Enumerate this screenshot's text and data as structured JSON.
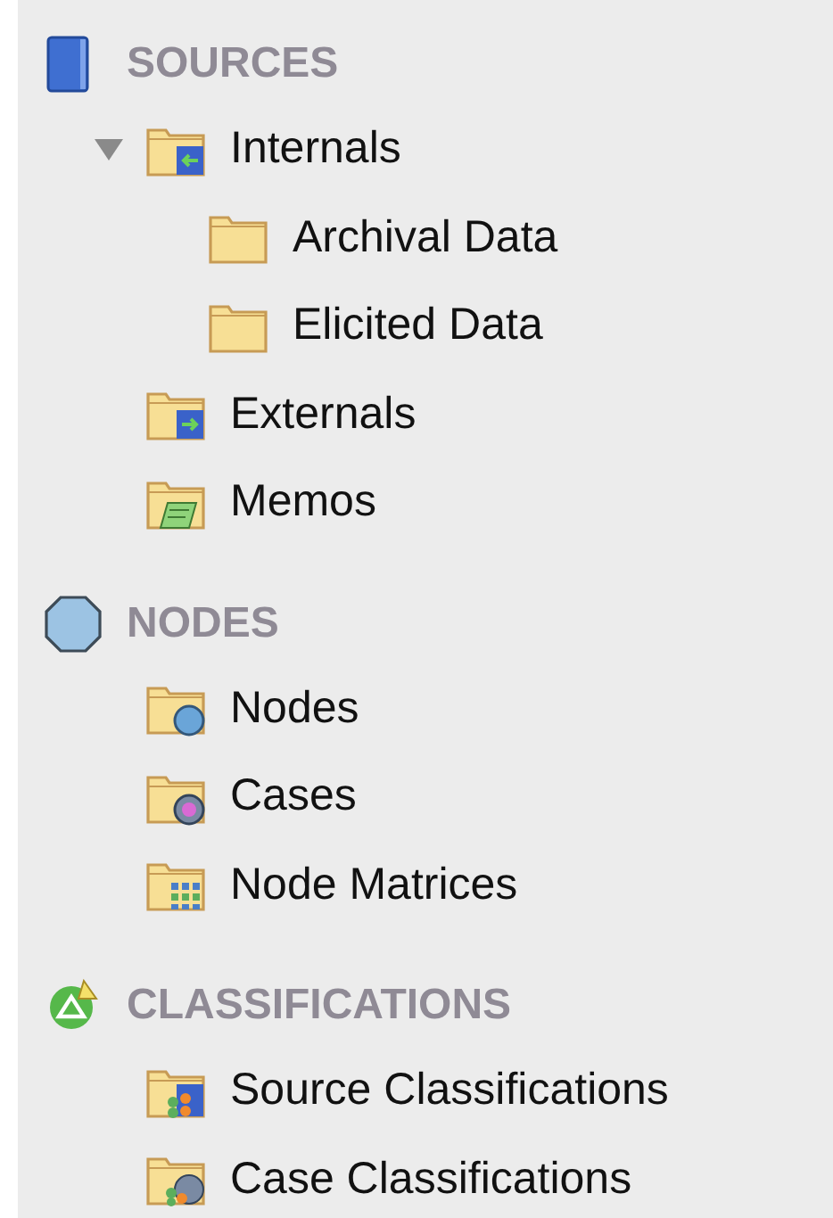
{
  "sections": [
    {
      "title": "SOURCES",
      "kind": "sources",
      "items": [
        {
          "label": "Internals",
          "kind": "internals",
          "expanded": true,
          "children": [
            {
              "label": "Archival Data",
              "kind": "folder"
            },
            {
              "label": "Elicited Data",
              "kind": "folder"
            }
          ]
        },
        {
          "label": "Externals",
          "kind": "externals"
        },
        {
          "label": "Memos",
          "kind": "memos"
        }
      ]
    },
    {
      "title": "NODES",
      "kind": "nodes",
      "items": [
        {
          "label": "Nodes",
          "kind": "nodes"
        },
        {
          "label": "Cases",
          "kind": "cases"
        },
        {
          "label": "Node Matrices",
          "kind": "matrices"
        }
      ]
    },
    {
      "title": "CLASSIFICATIONS",
      "kind": "classifications",
      "items": [
        {
          "label": "Source Classifications",
          "kind": "sourceclass"
        },
        {
          "label": "Case Classifications",
          "kind": "caseclass"
        }
      ]
    }
  ]
}
